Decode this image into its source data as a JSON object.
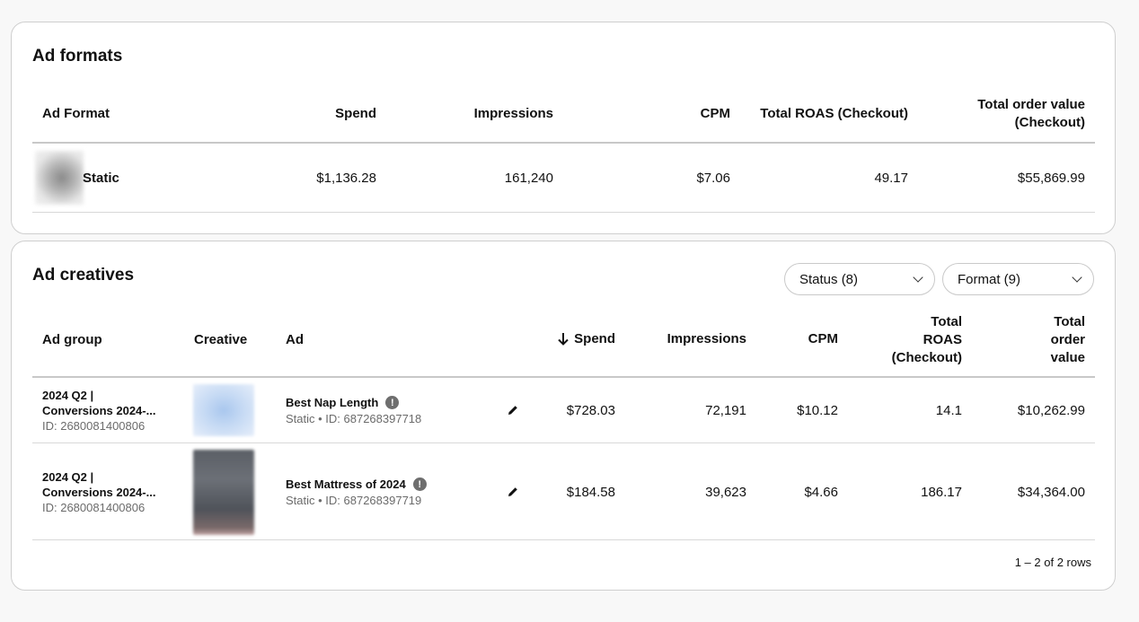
{
  "ad_formats": {
    "title": "Ad formats",
    "headers": {
      "ad_format": "Ad Format",
      "spend": "Spend",
      "impressions": "Impressions",
      "cpm": "CPM",
      "roas": "Total ROAS (Checkout)",
      "order_value_line1": "Total order value",
      "order_value_line2": "(Checkout)"
    },
    "rows": [
      {
        "format": "Static",
        "spend": "$1,136.28",
        "impressions": "161,240",
        "cpm": "$7.06",
        "roas": "49.17",
        "order_value": "$55,869.99"
      }
    ]
  },
  "ad_creatives": {
    "title": "Ad creatives",
    "filters": {
      "status": "Status (8)",
      "format": "Format (9)"
    },
    "headers": {
      "ad_group": "Ad group",
      "creative": "Creative",
      "ad": "Ad",
      "spend": "Spend",
      "impressions": "Impressions",
      "cpm": "CPM",
      "roas_line1": "Total",
      "roas_line2": "ROAS",
      "roas_line3": "(Checkout)",
      "order_line1": "Total",
      "order_line2": "order",
      "order_line3": "value"
    },
    "rows": [
      {
        "ad_group_line1": "2024 Q2 |",
        "ad_group_line2": "Conversions 2024-...",
        "ad_group_id": "ID: 2680081400806",
        "ad_name": "Best Nap Length",
        "ad_sub": "Static • ID: 687268397718",
        "spend": "$728.03",
        "impressions": "72,191",
        "cpm": "$10.12",
        "roas": "14.1",
        "order_value": "$10,262.99"
      },
      {
        "ad_group_line1": "2024 Q2 |",
        "ad_group_line2": "Conversions 2024-...",
        "ad_group_id": "ID: 2680081400806",
        "ad_name": "Best Mattress of 2024",
        "ad_sub": "Static • ID: 687268397719",
        "spend": "$184.58",
        "impressions": "39,623",
        "cpm": "$4.66",
        "roas": "186.17",
        "order_value": "$34,364.00"
      }
    ],
    "pagination": "1 – 2 of 2 rows"
  },
  "icons": {
    "sort": "arrow-down-icon",
    "edit": "pencil-icon",
    "warning": "exclamation-icon",
    "dropdown": "chevron-down-icon"
  }
}
